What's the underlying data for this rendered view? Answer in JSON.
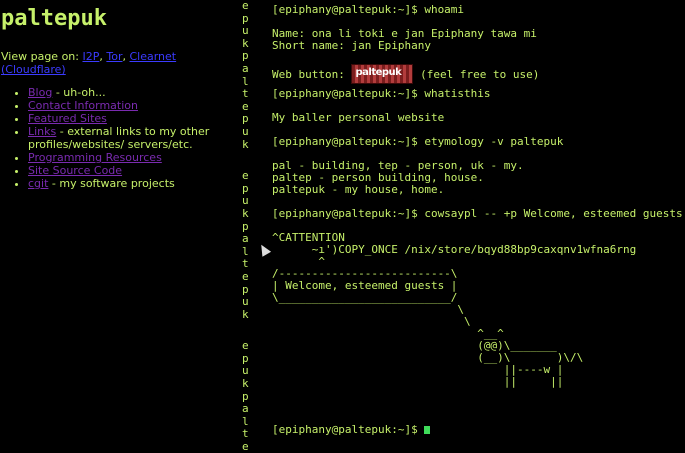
{
  "site": {
    "title": "paltepuk"
  },
  "view_on": {
    "prefix": "View page on: ",
    "links": [
      "I2P",
      "Tor",
      "Clearnet (Cloudflare)"
    ],
    "sep": ", "
  },
  "nav": {
    "items": [
      {
        "link": "Blog",
        "suffix": " - uh-oh..."
      },
      {
        "link": "Contact Information",
        "suffix": ""
      },
      {
        "link": "Featured Sites",
        "suffix": ""
      },
      {
        "link": "Links",
        "suffix": " - external links to my other profiles/websites/ servers/etc."
      },
      {
        "link": "Programming Resources",
        "suffix": ""
      },
      {
        "link": "Site Source Code",
        "suffix": ""
      },
      {
        "link": "cgit",
        "suffix": " - my software projects"
      }
    ]
  },
  "vertical_text": "epukpaltepuk",
  "terminal": {
    "lines": [
      "[epiphany@paltepuk:~]$ whoami",
      "",
      "Name: ona li toki e jan Epiphany tawa mi",
      "Short name: jan Epiphany",
      "",
      "",
      "",
      "[epiphany@paltepuk:~]$ whatisthis",
      "",
      "My baller personal website",
      "",
      "[epiphany@paltepuk:~]$ etymology -v paltepuk",
      "",
      "pal - building, tep - person, uk - my.",
      "paltep - person building, house.",
      "paltepuk - my house, home.",
      "",
      "[epiphany@paltepuk:~]$ cowsaypl -- +p Welcome, esteemed guests",
      "",
      "^CATTENTION",
      "      ~ı')COPY_ONCE /nix/store/bqyd88bp9caxqnv1wfna6rng",
      "       ^",
      "/--------------------------\\",
      "| Welcome, esteemed guests |",
      "\\__________________________/",
      "                            \\",
      "                             \\",
      "                               ^__^",
      "                               (@@)\\_______",
      "                               (__)\\       )\\/\\",
      "                                   ||----w |",
      "                                   ||     ||",
      "",
      "",
      ""
    ],
    "web_button_label": "Web button: ",
    "web_button_text": "paltepuk",
    "web_button_suffix": " (feel free to use)",
    "final_prompt": "[epiphany@paltepuk:~]$ "
  }
}
